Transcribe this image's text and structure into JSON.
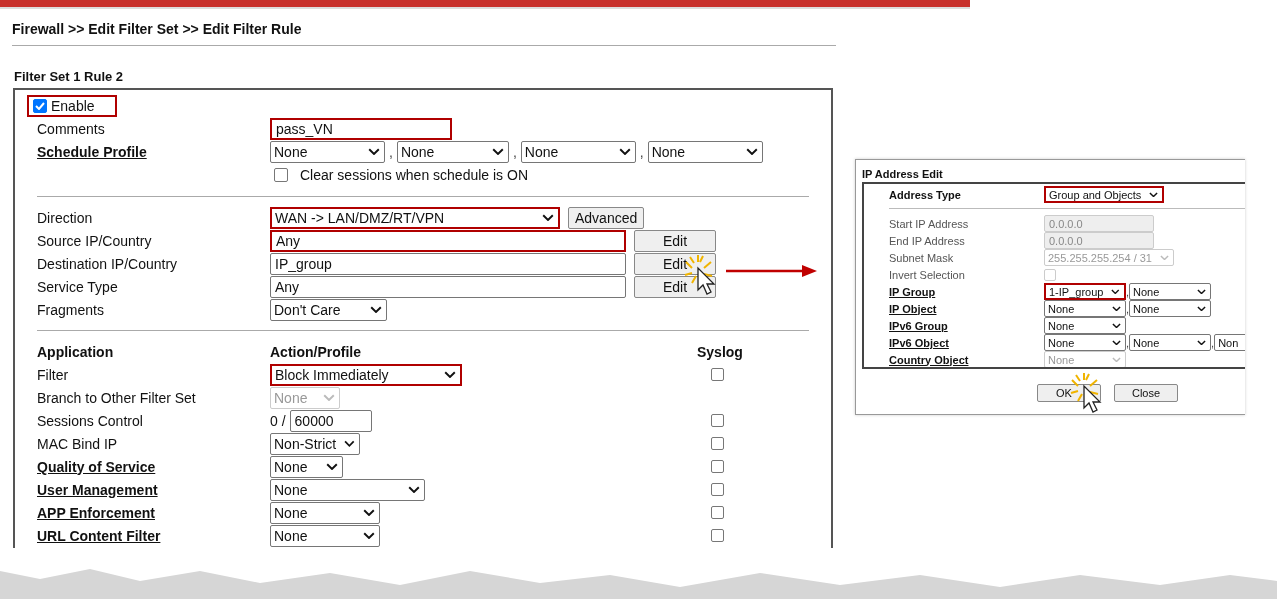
{
  "breadcrumb": "Firewall >> Edit Filter Set >> Edit Filter Rule",
  "rule": {
    "title": "Filter Set 1 Rule 2",
    "enable": {
      "label": "Enable",
      "checked": true,
      "highlighted": true
    },
    "groups": [
      {
        "rows": [
          {
            "label": "Comments",
            "link": false,
            "controls": [
              {
                "kind": "text",
                "value": "pass_VN",
                "highlighted": true
              }
            ]
          },
          {
            "label": "Schedule Profile",
            "link": true,
            "separator": ",",
            "controls": [
              {
                "kind": "select",
                "value": "None"
              },
              {
                "kind": "select",
                "value": "None"
              },
              {
                "kind": "select",
                "value": "None"
              },
              {
                "kind": "select",
                "value": "None"
              }
            ]
          },
          {
            "controls": [
              {
                "kind": "checkbox",
                "label": "Clear sessions when schedule is ON",
                "checked": false
              }
            ]
          }
        ]
      },
      {
        "rows": [
          {
            "label": "Direction",
            "link": false,
            "controls": [
              {
                "kind": "select",
                "value": "WAN -> LAN/DMZ/RT/VPN",
                "highlighted": true
              },
              {
                "kind": "button",
                "label": "Advanced"
              }
            ]
          },
          {
            "label": "Source IP/Country",
            "link": false,
            "controls": [
              {
                "kind": "text",
                "value": "Any",
                "highlighted": true
              },
              {
                "kind": "button",
                "label": "Edit"
              }
            ]
          },
          {
            "label": "Destination IP/Country",
            "link": false,
            "controls": [
              {
                "kind": "text",
                "value": "IP_group"
              },
              {
                "kind": "button",
                "label": "Edit"
              }
            ]
          },
          {
            "label": "Service Type",
            "link": false,
            "controls": [
              {
                "kind": "text",
                "value": "Any"
              },
              {
                "kind": "button",
                "label": "Edit"
              }
            ]
          },
          {
            "label": "Fragments",
            "link": false,
            "controls": [
              {
                "kind": "select",
                "value": "Don't Care"
              }
            ]
          }
        ]
      },
      {
        "header": {
          "application": "Application",
          "action": "Action/Profile",
          "syslog": "Syslog"
        },
        "rows": [
          {
            "label": "Filter",
            "link": false,
            "controls": [
              {
                "kind": "select",
                "value": "Block Immediately",
                "highlighted": true
              }
            ],
            "syslog": {
              "checked": false
            }
          },
          {
            "label": "Branch to Other Filter Set",
            "link": false,
            "controls": [
              {
                "kind": "select",
                "value": "None",
                "disabled": true
              }
            ]
          },
          {
            "label": "Sessions Control",
            "link": false,
            "controls": [
              {
                "kind": "note",
                "value": "0 /"
              },
              {
                "kind": "text",
                "value": "60000"
              }
            ],
            "syslog": {
              "checked": false
            }
          },
          {
            "label": "MAC Bind IP",
            "link": false,
            "controls": [
              {
                "kind": "select",
                "value": "Non-Strict"
              }
            ],
            "syslog": {
              "checked": false
            }
          },
          {
            "label": "Quality of Service",
            "link": true,
            "controls": [
              {
                "kind": "select",
                "value": "None"
              }
            ],
            "syslog": {
              "checked": false
            }
          },
          {
            "label": "User Management",
            "link": true,
            "controls": [
              {
                "kind": "select",
                "value": "None"
              }
            ],
            "syslog": {
              "checked": false
            }
          },
          {
            "label": "APP Enforcement",
            "link": true,
            "controls": [
              {
                "kind": "select",
                "value": "None"
              }
            ],
            "syslog": {
              "checked": false
            }
          },
          {
            "label": "URL Content Filter",
            "link": true,
            "controls": [
              {
                "kind": "select",
                "value": "None"
              }
            ],
            "syslog": {
              "checked": false
            }
          }
        ]
      }
    ]
  },
  "ip_edit": {
    "title": "IP Address Edit",
    "address_type": {
      "label": "Address Type",
      "controls": [
        {
          "kind": "select",
          "value": "Group and Objects",
          "highlighted": true
        }
      ]
    },
    "rows": [
      {
        "label": "Start IP Address",
        "link": false,
        "controls": [
          {
            "kind": "text",
            "value": "0.0.0.0",
            "disabled": true
          }
        ]
      },
      {
        "label": "End IP Address",
        "link": false,
        "controls": [
          {
            "kind": "text",
            "value": "0.0.0.0",
            "disabled": true
          }
        ]
      },
      {
        "label": "Subnet Mask",
        "link": false,
        "controls": [
          {
            "kind": "select",
            "value": "255.255.255.254 / 31",
            "disabled": true
          }
        ]
      },
      {
        "label": "Invert Selection",
        "link": false,
        "controls": [
          {
            "kind": "checkbox",
            "checked": false,
            "disabled": true
          }
        ]
      },
      {
        "label": "IP Group",
        "link": true,
        "separator": ",",
        "controls": [
          {
            "kind": "select",
            "value": "1-IP_group",
            "highlighted": true
          },
          {
            "kind": "select",
            "value": "None"
          }
        ]
      },
      {
        "label": "IP Object",
        "link": true,
        "separator": ",",
        "controls": [
          {
            "kind": "select",
            "value": "None"
          },
          {
            "kind": "select",
            "value": "None"
          }
        ]
      },
      {
        "label": "IPv6 Group",
        "link": true,
        "controls": [
          {
            "kind": "select",
            "value": "None"
          }
        ]
      },
      {
        "label": "IPv6 Object",
        "link": true,
        "separator": ",",
        "controls": [
          {
            "kind": "select",
            "value": "None"
          },
          {
            "kind": "select",
            "value": "None"
          },
          {
            "kind": "select",
            "value": "Non"
          }
        ]
      },
      {
        "label": "Country Object",
        "link": true,
        "controls": [
          {
            "kind": "select",
            "value": "None",
            "disabled": true
          }
        ]
      }
    ],
    "buttons": [
      {
        "label": "OK"
      },
      {
        "label": "Close"
      }
    ]
  }
}
